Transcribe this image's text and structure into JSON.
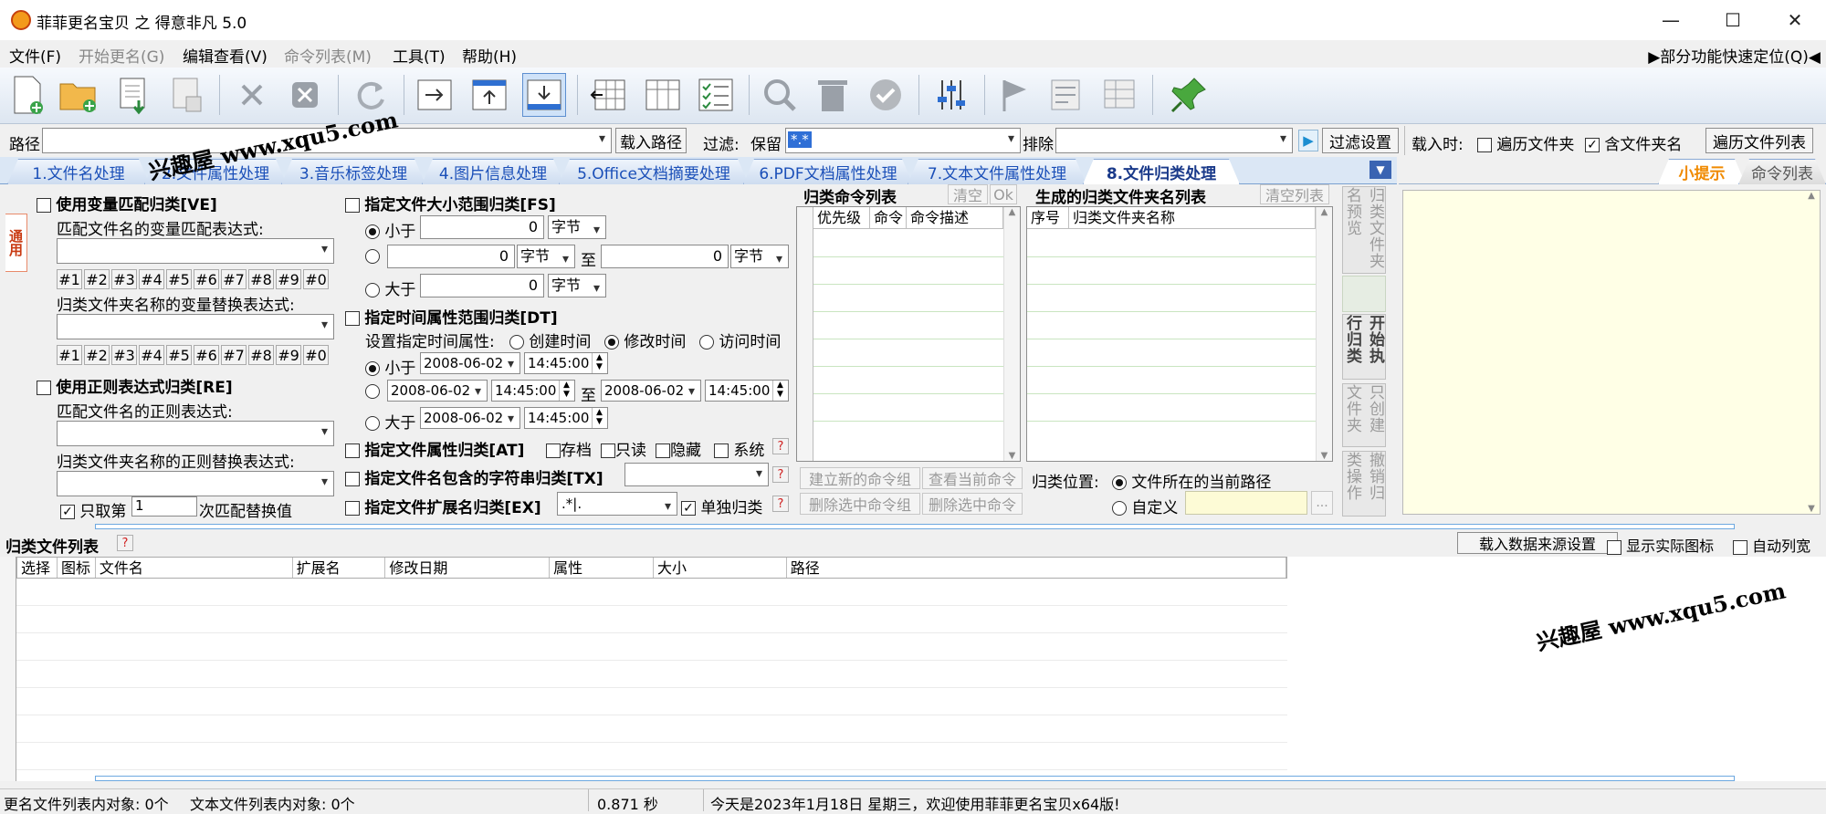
{
  "window": {
    "title": "菲菲更名宝贝 之 得意非凡 5.0",
    "minimize": "—",
    "maximize": "☐",
    "close": "✕"
  },
  "menu": {
    "items": [
      "文件(F)",
      "开始更名(G)",
      "编辑查看(V)",
      "命令列表(M)",
      "工具(T)",
      "帮助(H)"
    ],
    "quick_nav": "▶部分功能快速定位(Q)◀"
  },
  "pathbar": {
    "path_label": "路径",
    "load_path": "载入路径",
    "filter_label": "过滤:",
    "keep_label": "保留",
    "keep_value": "*.*",
    "exclude_label": "排除",
    "filter_settings": "过滤设置",
    "load_time_label": "载入时:",
    "traverse_folder": "遍历文件夹",
    "include_folder_name": "含文件夹名",
    "traverse_file_list": "遍历文件列表"
  },
  "tabs": [
    "1.文件名处理",
    "2.文件属性处理",
    "3.音乐标签处理",
    "4.图片信息处理",
    "5.Office文档摘要处理",
    "6.PDF文档属性处理",
    "7.文本文件属性处理",
    "8.文件归类处理"
  ],
  "side_tab": "通用",
  "left": {
    "ve_title": "使用变量匹配归类[VE]",
    "ve_match_label": "匹配文件名的变量匹配表达式:",
    "ve_replace_label": "归类文件夹名称的变量替换表达式:",
    "var_buttons": [
      "#1",
      "#2",
      "#3",
      "#4",
      "#5",
      "#6",
      "#7",
      "#8",
      "#9",
      "#0"
    ],
    "re_title": "使用正则表达式归类[RE]",
    "re_match_label": "匹配文件名的正则表达式:",
    "re_replace_label": "归类文件夹名称的正则替换表达式:",
    "only_take": "只取第",
    "only_take_value": "1",
    "only_take_suffix": "次匹配替换值"
  },
  "middle": {
    "fs_title": "指定文件大小范围归类[FS]",
    "less_than": "小于",
    "greater_than": "大于",
    "to": "至",
    "size_value": "0",
    "size_unit": "字节",
    "dt_title": "指定时间属性范围归类[DT]",
    "time_attr_label": "设置指定时间属性:",
    "time_created": "创建时间",
    "time_modified": "修改时间",
    "time_accessed": "访问时间",
    "date_value": "2008-06-02",
    "time_value": "14:45:00",
    "at_title": "指定文件属性归类[AT]",
    "attr_archive": "存档",
    "attr_readonly": "只读",
    "attr_hidden": "隐藏",
    "attr_system": "系统",
    "tx_title": "指定文件名包含的字符串归类[TX]",
    "ex_title": "指定文件扩展名归类[EX]",
    "ex_value": ".*|.",
    "ex_single": "单独归类",
    "help": "?"
  },
  "commands": {
    "title": "归类命令列表",
    "clear": "清空",
    "ok": "Ok",
    "columns": [
      "优先级",
      "命令",
      "命令描述"
    ],
    "new_group": "建立新的命令组",
    "view_current": "查看当前命令",
    "delete_group": "删除选中命令组",
    "delete_cmd": "删除选中命令"
  },
  "folders": {
    "title": "生成的归类文件夹名列表",
    "clear": "清空列表",
    "columns": [
      "序号",
      "归类文件夹名称"
    ],
    "location_label": "归类位置:",
    "loc_current": "文件所在的当前路径",
    "loc_custom": "自定义",
    "browse": "..."
  },
  "side_buttons": [
    "归类文件夹名预览",
    "开始执行归类",
    "只创建文件夹",
    "撤销归类操作"
  ],
  "right": {
    "tab_tips": "小提示",
    "tab_commands": "命令列表"
  },
  "filelist": {
    "title": "归类文件列表",
    "help": "?",
    "load_source": "载入数据来源设置",
    "show_icon": "显示实际图标",
    "auto_width": "自动列宽",
    "columns": [
      "选择",
      "图标",
      "文件名",
      "扩展名",
      "修改日期",
      "属性",
      "大小",
      "路径"
    ]
  },
  "status": {
    "rename_count": "更名文件列表内对象: 0个",
    "text_count": "文本文件列表内对象: 0个",
    "elapsed": "0.871 秒",
    "message": "今天是2023年1月18日 星期三，欢迎使用菲菲更名宝贝x64版!"
  },
  "watermark": "兴趣屋 www.xqu5.com"
}
